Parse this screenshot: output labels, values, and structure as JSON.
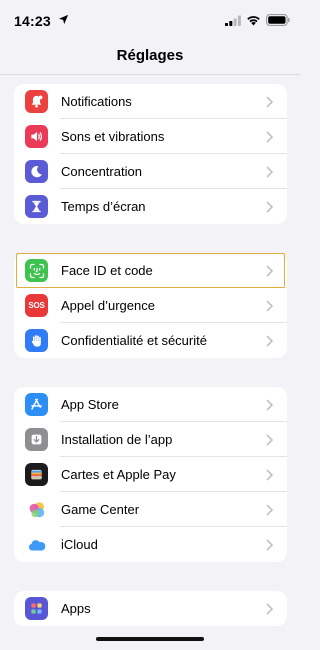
{
  "status": {
    "time": "14:23"
  },
  "header": {
    "title": "Réglages"
  },
  "groups": [
    {
      "items": [
        {
          "label": "Notifications",
          "icon": "bell-icon",
          "color": "#eb4240"
        },
        {
          "label": "Sons et vibrations",
          "icon": "speaker-icon",
          "color": "#eb3a57"
        },
        {
          "label": "Concentration",
          "icon": "moon-icon",
          "color": "#5b5bd6"
        },
        {
          "label": "Temps d’écran",
          "icon": "hourglass-icon",
          "color": "#5b5bd6"
        }
      ]
    },
    {
      "items": [
        {
          "label": "Face ID et code",
          "icon": "face-id-icon",
          "color": "#3ec34e",
          "highlighted": true
        },
        {
          "label": "Appel d’urgence",
          "icon": "sos-icon",
          "icon_text": "SOS",
          "color": "#e8383a"
        },
        {
          "label": "Confidentialité et sécurité",
          "icon": "hand-icon",
          "color": "#2f7cf6"
        }
      ]
    },
    {
      "items": [
        {
          "label": "App Store",
          "icon": "app-store-icon",
          "color": "#2b8ff5"
        },
        {
          "label": "Installation de l’app",
          "icon": "download-icon",
          "color": "#8e8e93"
        },
        {
          "label": "Cartes et Apple Pay",
          "icon": "wallet-icon",
          "color": "#1c1c1e"
        },
        {
          "label": "Game Center",
          "icon": "game-center-icon",
          "color": "#ffffff"
        },
        {
          "label": "iCloud",
          "icon": "cloud-icon",
          "color": "#ffffff"
        }
      ]
    },
    {
      "items": [
        {
          "label": "Apps",
          "icon": "apps-grid-icon",
          "color": "#5856d6"
        }
      ]
    }
  ],
  "colors": {
    "background": "#f2f2f7",
    "highlight_border": "#e2ad3d",
    "chevron": "#c4c4c7"
  }
}
